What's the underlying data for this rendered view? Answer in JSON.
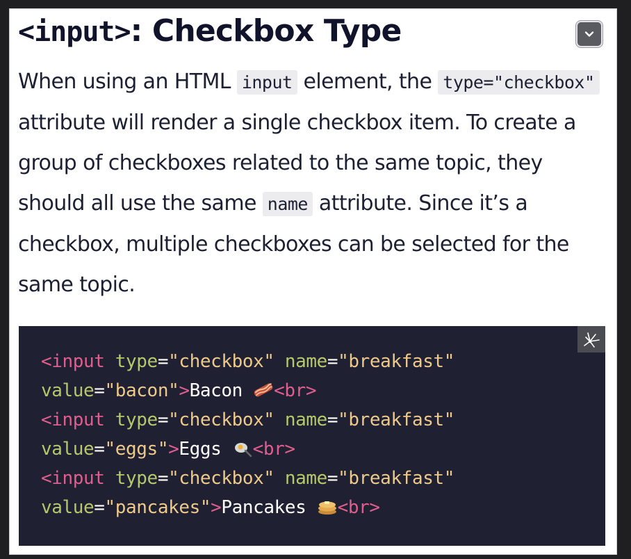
{
  "heading": {
    "tag_text": "<input>",
    "rest_text": ": Checkbox Type"
  },
  "collapse_button": {
    "icon": "chevron-down-icon"
  },
  "paragraph": {
    "s1": "When using an HTML ",
    "c1": "input",
    "s2": " element, the ",
    "c2": "type=\"checkbox\"",
    "s3": " attribute will render a single checkbox item. To create a group of checkboxes related to the same topic, they should all use the same ",
    "c3": "name",
    "s4": " attribute. Since it’s a checkbox, multiple checkboxes can be selected for the same topic."
  },
  "code": {
    "lines": [
      {
        "open": "<input",
        "attr1": "type",
        "eq1": "=",
        "val1": "\"checkbox\"",
        "attr2": "name",
        "eq2": "=",
        "val2": "\"breakfast\"",
        "attr3": "value",
        "eq3": "=",
        "val3": "\"bacon\"",
        "close": ">",
        "text": "Bacon ",
        "br": "<br>",
        "emoji": "bacon-emoji"
      },
      {
        "open": "<input",
        "attr1": "type",
        "eq1": "=",
        "val1": "\"checkbox\"",
        "attr2": "name",
        "eq2": "=",
        "val2": "\"breakfast\"",
        "attr3": "value",
        "eq3": "=",
        "val3": "\"eggs\"",
        "close": ">",
        "text": "Eggs ",
        "br": "<br>",
        "emoji": "fried-egg-emoji"
      },
      {
        "open": "<input",
        "attr1": "type",
        "eq1": "=",
        "val1": "\"checkbox\"",
        "attr2": "name",
        "eq2": "=",
        "val2": "\"breakfast\"",
        "attr3": "value",
        "eq3": "=",
        "val3": "\"pancakes\"",
        "close": ">",
        "text": "Pancakes ",
        "br": "<br>",
        "emoji": "pancakes-emoji"
      }
    ],
    "copy_icon": "sparkle-copy-icon"
  },
  "colors": {
    "code_background": "#202033",
    "tag": "#e05e8e",
    "attribute": "#b5c86a",
    "string": "#eec98a"
  }
}
